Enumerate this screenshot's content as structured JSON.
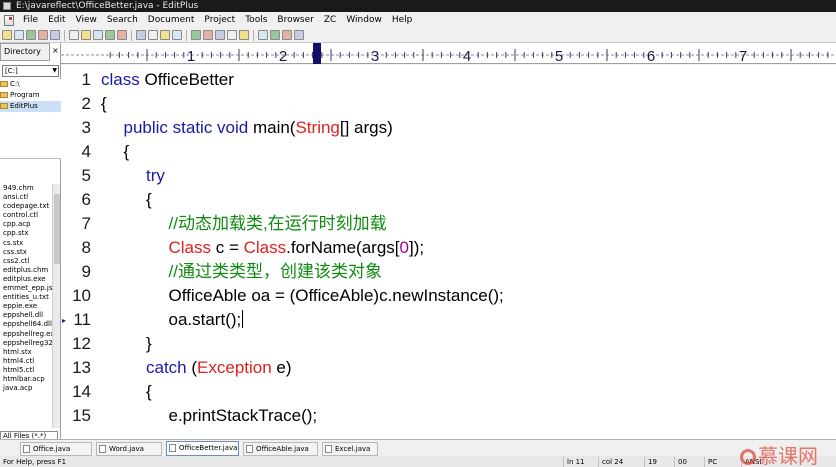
{
  "window": {
    "title": "E:\\javareflect\\OfficeBetter.java - EditPlus"
  },
  "menu": [
    "File",
    "Edit",
    "View",
    "Search",
    "Document",
    "Project",
    "Tools",
    "Browser",
    "ZC",
    "Window",
    "Help"
  ],
  "toolbar_icons": [
    "new-file-icon",
    "open-icon",
    "save-icon",
    "save-all-icon",
    "print-icon",
    "print-preview-icon",
    "spell-icon",
    "cut-icon",
    "copy-icon",
    "paste-icon",
    "find-icon",
    "replace-icon",
    "undo-icon",
    "redo-icon",
    "word-wrap-icon",
    "ruler-icon",
    "line-number-icon",
    "browser-icon",
    "cliptext-icon",
    "directory-icon",
    "output-icon",
    "fullscreen-icon",
    "check-icon"
  ],
  "left_panel": {
    "tab_label": "Directory",
    "drive": "[C:]",
    "folders": [
      {
        "name": "C:\\",
        "selected": false
      },
      {
        "name": "Program",
        "selected": false
      },
      {
        "name": "EditPlus",
        "selected": true
      }
    ],
    "files": [
      "949.chm",
      "ansi.ctl",
      "codepage.txt",
      "control.ctl",
      "cpp.acp",
      "cpp.stx",
      "cs.stx",
      "css.stx",
      "css2.ctl",
      "editplus.chm",
      "editplus.exe",
      "emmet_epp.js",
      "entities_u.txt",
      "eppie.exe",
      "eppshell.dll",
      "eppshell64.dll",
      "eppshellreg.exe",
      "eppshellreg32.exe",
      "html.stx",
      "html4.ctl",
      "html5.ctl",
      "htmlbar.acp",
      "java.acp"
    ],
    "filter": "All Files (*.*)"
  },
  "ruler": {
    "labels": [
      "1",
      "2",
      "3",
      "4",
      "5",
      "6",
      "7"
    ]
  },
  "editor": {
    "lines": [
      {
        "n": "1",
        "indent": 0,
        "tokens": [
          [
            "kw",
            "class "
          ],
          [
            "t",
            "OfficeBetter"
          ]
        ]
      },
      {
        "n": "2",
        "indent": 0,
        "tokens": [
          [
            "t",
            "{"
          ]
        ]
      },
      {
        "n": "3",
        "indent": 1,
        "tokens": [
          [
            "kw",
            "public static void "
          ],
          [
            "t",
            "main("
          ],
          [
            "cls",
            "String"
          ],
          [
            "t",
            "[] args)"
          ]
        ]
      },
      {
        "n": "4",
        "indent": 1,
        "tokens": [
          [
            "t",
            "{"
          ]
        ]
      },
      {
        "n": "5",
        "indent": 2,
        "tokens": [
          [
            "kw",
            "try"
          ]
        ]
      },
      {
        "n": "6",
        "indent": 2,
        "tokens": [
          [
            "t",
            "{"
          ]
        ]
      },
      {
        "n": "7",
        "indent": 3,
        "tokens": [
          [
            "cm",
            "//动态加载类,在运行时刻加载"
          ]
        ]
      },
      {
        "n": "8",
        "indent": 3,
        "tokens": [
          [
            "cls",
            "Class"
          ],
          [
            "t",
            " c = "
          ],
          [
            "cls",
            "Class"
          ],
          [
            "t",
            ".forName(args["
          ],
          [
            "num",
            "0"
          ],
          [
            "t",
            "]);"
          ]
        ]
      },
      {
        "n": "9",
        "indent": 3,
        "tokens": [
          [
            "cm",
            "//通过类类型，创建该类对象"
          ]
        ]
      },
      {
        "n": "10",
        "indent": 3,
        "tokens": [
          [
            "t",
            "OfficeAble oa = (OfficeAble)c.newInstance();"
          ]
        ]
      },
      {
        "n": "11",
        "indent": 3,
        "tokens": [
          [
            "t",
            "oa.start();"
          ]
        ],
        "caret": true,
        "marker": "▸"
      },
      {
        "n": "12",
        "indent": 2,
        "tokens": [
          [
            "t",
            "}"
          ]
        ]
      },
      {
        "n": "13",
        "indent": 2,
        "tokens": [
          [
            "kw",
            "catch "
          ],
          [
            "t",
            "("
          ],
          [
            "cls",
            "Exception"
          ],
          [
            "t",
            " e)"
          ]
        ]
      },
      {
        "n": "14",
        "indent": 2,
        "tokens": [
          [
            "t",
            "{"
          ]
        ]
      },
      {
        "n": "15",
        "indent": 3,
        "tokens": [
          [
            "t",
            "e.printStackTrace();"
          ]
        ]
      }
    ]
  },
  "tabs": [
    {
      "label": "Office.java",
      "active": false
    },
    {
      "label": "Word.java",
      "active": false
    },
    {
      "label": "OfficeBetter.java",
      "active": true
    },
    {
      "label": "OfficeAble.java",
      "active": false
    },
    {
      "label": "Excel.java",
      "active": false
    }
  ],
  "status": {
    "help": "For Help, press F1",
    "line": "ln 11",
    "col": "col 24",
    "num1": "19",
    "num2": "00",
    "mode": "PC",
    "encoding": "ANSI"
  },
  "watermark": "慕课网",
  "colors": {
    "keyword": "#1a1aa8",
    "class": "#e02020",
    "comment": "#108a10",
    "number": "#a000a0"
  }
}
